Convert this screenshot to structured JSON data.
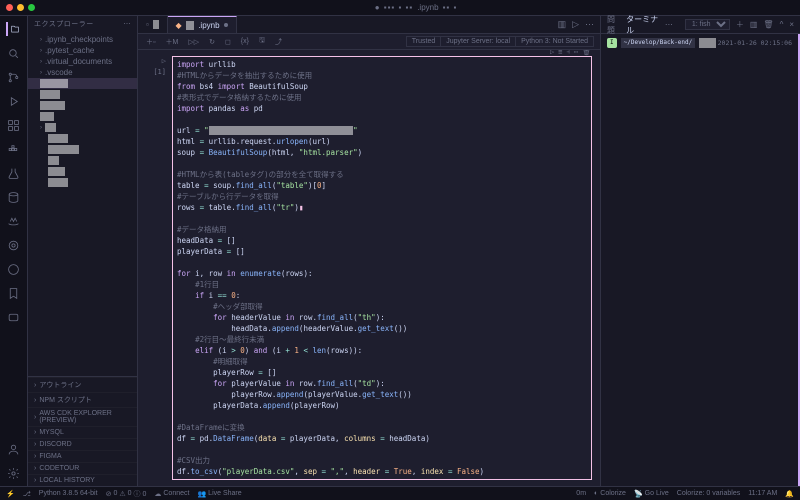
{
  "title": {
    "file": ".ipynb",
    "workspace_prefix": "● ▪▪▪ ▪ ▪▪"
  },
  "sidebar": {
    "title": "エクスプローラー",
    "tree": [
      {
        "label": ".ipynb_checkpoints",
        "kind": "folder"
      },
      {
        "label": ".pytest_cache",
        "kind": "folder"
      },
      {
        "label": ".virtual_documents",
        "kind": "folder"
      },
      {
        "label": ".vscode",
        "kind": "folder"
      }
    ],
    "sections": [
      "アウトライン",
      "NPM スクリプト",
      "AWS CDK EXPLORER (PREVIEW)",
      "MYSQL",
      "DISCORD",
      "FIGMA",
      "CODETOUR",
      "LOCAL HISTORY"
    ]
  },
  "tabs": [
    {
      "label": ".ipynb",
      "active": true
    }
  ],
  "notebook_toolbar": {
    "trusted": "Trusted",
    "server": "Jupyter Server: local",
    "kernel": "Python 3: Not Started"
  },
  "cell": {
    "prompt": "[1]",
    "add_label": "▷ ▪▪"
  },
  "code": [
    {
      "t": "import urllib",
      "cls": [
        "kw",
        "var"
      ]
    },
    {
      "t": "#HTMLからデータを抽出するために使用"
    },
    {
      "t": "from bs4 import BeautifulSoup"
    },
    {
      "t": "#表形式でデータ格納するために使用"
    },
    {
      "t": "import pandas as pd"
    },
    {
      "t": ""
    },
    {
      "t": "url = \"▪▪   ▪ ▪ ▪▪▪▪▪▪▪▪▪ ▪  ▪ ▪  ▪  ▪▪\""
    },
    {
      "t": "html = urllib.request.urlopen(url)"
    },
    {
      "t": "soup = BeautifulSoup(html, \"html.parser\")"
    },
    {
      "t": ""
    },
    {
      "t": "#HTMLから表(tableタグ)の部分を全て取得する"
    },
    {
      "t": "table = soup.find_all(\"table\")[0]"
    },
    {
      "t": "#テーブルから行データを取得"
    },
    {
      "t": "rows = table.find_all(\"tr\")"
    },
    {
      "t": ""
    },
    {
      "t": "#データ格納用"
    },
    {
      "t": "headData = []"
    },
    {
      "t": "playerData = []"
    },
    {
      "t": ""
    },
    {
      "t": "for i, row in enumerate(rows):"
    },
    {
      "t": "    #1行目"
    },
    {
      "t": "    if i == 0:"
    },
    {
      "t": "        #ヘッダ部取得"
    },
    {
      "t": "        for headerValue in row.find_all(\"th\"):"
    },
    {
      "t": "            headData.append(headerValue.get_text())"
    },
    {
      "t": "    #2行目〜最終行未満"
    },
    {
      "t": "    elif (i > 0) and (i + 1 < len(rows)):"
    },
    {
      "t": "        #明細取得"
    },
    {
      "t": "        playerRow = []"
    },
    {
      "t": "        for playerValue in row.find_all(\"td\"):"
    },
    {
      "t": "            playerRow.append(playerValue.get_text())"
    },
    {
      "t": "        playerData.append(playerRow)"
    },
    {
      "t": ""
    },
    {
      "t": "#DataFrameに変換"
    },
    {
      "t": "df = pd.DataFrame(data = playerData, columns = headData)"
    },
    {
      "t": ""
    },
    {
      "t": "#CSV出力"
    },
    {
      "t": "df.to_csv(\"playerData.csv\", sep = \",\", header = True, index = False)"
    }
  ],
  "terminal": {
    "title_prefix": "問題",
    "title": "ターミナル",
    "shell": "1: fish",
    "cwd": "~/Develop/Back-end/",
    "timestamp": "2021-01-26 02:15:06"
  },
  "statusbar": {
    "python": "Python 3.8.5 64-bit",
    "errors": "0",
    "warnings": "0",
    "connect": "Connect",
    "liveshare": "Live Share",
    "right": [
      "0m",
      "Colorize",
      "Go Live",
      "Colorize: 0 variables",
      "11:17 AM"
    ]
  }
}
